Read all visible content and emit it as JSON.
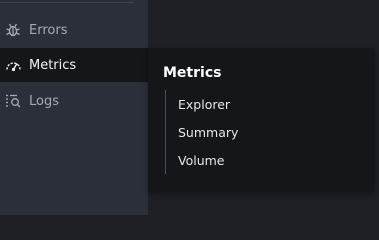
{
  "sidebar": {
    "items": [
      {
        "label": "Errors",
        "icon": "bug-icon"
      },
      {
        "label": "Metrics",
        "icon": "speedometer-icon"
      },
      {
        "label": "Logs",
        "icon": "logs-search-icon"
      }
    ]
  },
  "flyout": {
    "title": "Metrics",
    "items": [
      {
        "label": "Explorer"
      },
      {
        "label": "Summary"
      },
      {
        "label": "Volume"
      }
    ]
  },
  "colors": {
    "sidebar_bg": "#2b2f3a",
    "active_bg": "#15161a",
    "text": "#e6e7ea"
  }
}
